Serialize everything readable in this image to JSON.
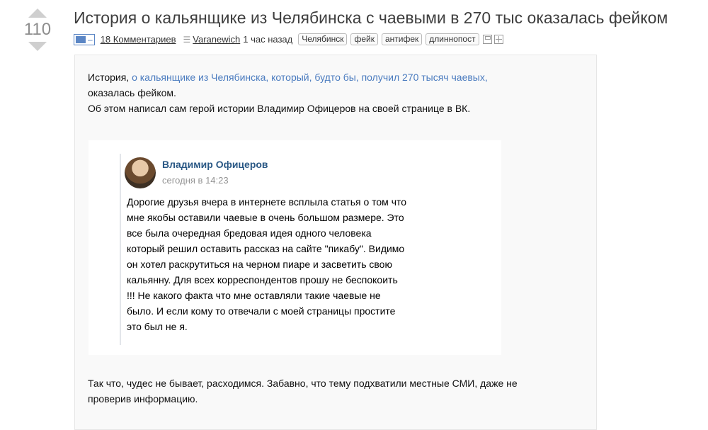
{
  "vote": {
    "rating": "110"
  },
  "post": {
    "title": "История о кальянщике из Челябинска с чаевыми в 270 тыс оказалась фейком",
    "comments": "18 Комментариев",
    "author": "Varanewich",
    "time": "1 час назад",
    "tags": [
      "Челябинск",
      "фейк",
      "антифек",
      "длиннопост"
    ]
  },
  "body": {
    "intro_prefix": "История, ",
    "intro_link": "о кальянщике из Челябинска, который, будто бы, получил 270 тысяч чаевых,",
    "intro_rest": "оказалась фейком.",
    "intro_line2": "Об этом написал сам герой истории Владимир Офицеров на своей странице в ВК.",
    "vk_post": {
      "author": "Владимир Офицеров",
      "time": "сегодня в 14:23",
      "lines": [
        "Дорогие друзья вчера в интернете всплыла статья о том что",
        "мне якобы оставили чаевые в очень большом размере. Это",
        "все была очередная бредовая идея одного человека",
        "который решил оставить рассказ на сайте \"пикабу\". Видимо",
        "он хотел раскрутиться на черном пиаре и засветить свою",
        "кальянну. Для всех корреспондентов прошу не беспокоить",
        "!!! Не какого факта что мне оставляли такие чаевые не",
        "было. И если кому то отвечали с моей страницы простите",
        "это был не я."
      ]
    },
    "outro_line1": "Так что, чудес не бывает, расходимся. Забавно, что тему подхватили местные СМИ, даже не",
    "outro_line2": "проверив информацию."
  }
}
